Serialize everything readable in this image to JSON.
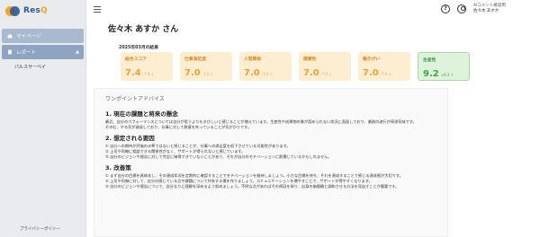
{
  "brand": {
    "name_main": "Res",
    "name_accent": "Q"
  },
  "sidebar": {
    "items": [
      {
        "label": "マイページ"
      },
      {
        "label": "レポート"
      }
    ],
    "subitems": [
      {
        "label": "パルスサーベイ"
      }
    ],
    "footer": "プライバシーポリシー"
  },
  "header": {
    "help_symbol": "?",
    "user_role": "AIコメント確認用",
    "user_name": "佐々木 あすか"
  },
  "main": {
    "title": "佐々木 あすか さん",
    "period": "2025年03月の結果"
  },
  "cards": [
    {
      "label": "総合スコア",
      "value": "7.4",
      "delta": "-7.4 ↓",
      "status": "orange"
    },
    {
      "label": "仕事満足度",
      "value": "7.0",
      "delta": "-7.0 ↓",
      "status": "orange"
    },
    {
      "label": "人間関係",
      "value": "7.0",
      "delta": "-7.0 ↓",
      "status": "orange"
    },
    {
      "label": "健康性",
      "value": "7.0",
      "delta": "-7.0 ↓",
      "status": "orange"
    },
    {
      "label": "働きがい",
      "value": "7.0",
      "delta": "-7.0 ↓",
      "status": "orange"
    },
    {
      "label": "生産性",
      "value": "9.2",
      "delta": "+9.2 ↑",
      "status": "green"
    }
  ],
  "advice": {
    "title": "ワンポイントアドバイス",
    "sections": [
      {
        "heading": "1. 現在の課題と将来の懸念",
        "lines": [
          "最近、自分のパフォーマンスについては自分が思うよりもきびしいと感じることが増えています。生産性や成果物の質が認められない状況に直面しており、業務の遂行が停滞気味です。",
          "そのむ、やる気が減退しており、仕事に対して熱意を失っていることが気がかりです。"
        ]
      },
      {
        "heading": "2. 想定される要因",
        "lines": [
          "① 自分への期待が評価の水準ではないと感じることが、仕事への満足度を低下させている可能性があります。",
          "② 上司や同僚に相談できる関係性がなく、サポートが得られないと感じています。",
          "③ 自分のビジョンや理念に対して完全に納得できていないことがあり、それが自分のモチベーションに影響しているかもしれません。"
        ]
      },
      {
        "heading": "3. 改善策",
        "lines": [
          "① まず自分の目標を具体化し、その達成状況を定期的に確認することでモチベーションを維持しましょう。小さな目標を持ち、それを達成することで感じる達成感が大切です。",
          "② 上司や同僚に対して、自分の感じている点や課題について共有する場を作りましょう。コミュニケーションを増やすことで、サポートが得やすくなります。",
          "③ 自分のビジョンや理念について、自分なりに理解を深めるよう努めましょう。不明な点があればその原因を探り、自身の価値観と調和させる方法を見出すことが重要です。"
        ]
      }
    ]
  },
  "colors": {
    "sidebar_bg": "#e9ebee",
    "nav_active": "#8ea4c2",
    "card_orange": "#fdeed2",
    "card_green": "#dff3dc",
    "accent_orange": "#f0a03a",
    "accent_green": "#3aa64a"
  }
}
